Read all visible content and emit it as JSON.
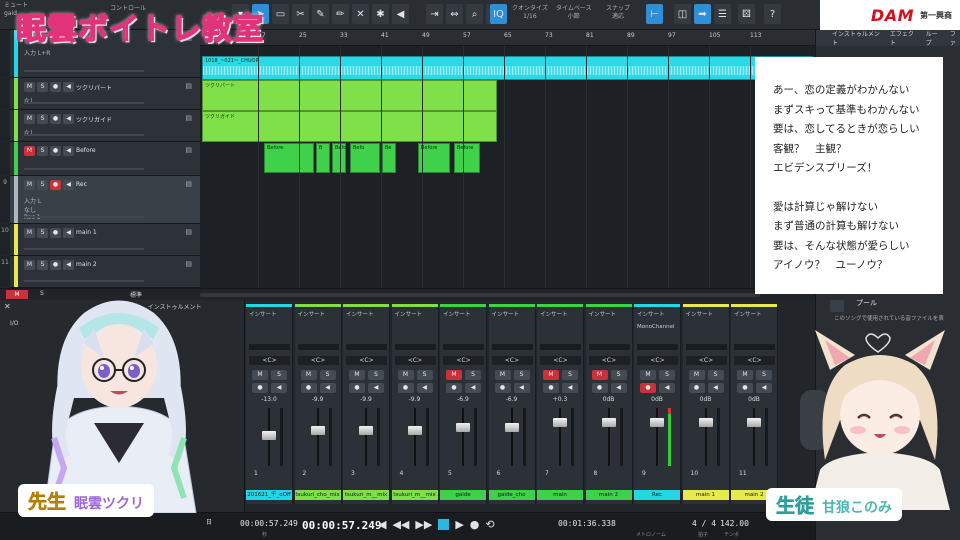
{
  "overlay": {
    "title": "眠雲ボイトレ教室",
    "teacher_role": "先生",
    "teacher_name": "眠雲ツクリ",
    "student_role": "生徒",
    "student_name": "甘狼このみ"
  },
  "brand": {
    "logo": "DAM",
    "sub": "第一興商"
  },
  "toolbar": {
    "left_label_1": "ミュート",
    "left_label_2": "gaid",
    "control_label": "コントロール",
    "quantize_label": "クオンタイズ",
    "quantize_value": "1/16",
    "timebase_label": "タイムベース",
    "timebase_value": "小節",
    "snap_label": "スナップ",
    "snap_value": "適応"
  },
  "ruler": {
    "ticks": [
      "17",
      "25",
      "33",
      "41",
      "49",
      "57",
      "65",
      "73",
      "81",
      "89",
      "97",
      "105",
      "113"
    ]
  },
  "tracks": [
    {
      "num": "",
      "name": "",
      "input": "入力 L+R",
      "color": "#22d7e6",
      "buttons": [
        "M",
        "S"
      ],
      "m_on": false,
      "rec_on": false
    },
    {
      "num": "",
      "name": "ツクリパート",
      "input": "なし",
      "color": "#7fe04a",
      "buttons": [
        "M",
        "S"
      ],
      "m_on": false,
      "rec_on": false
    },
    {
      "num": "",
      "name": "ツクリガイド",
      "input": "なし",
      "color": "#7fe04a",
      "buttons": [
        "M",
        "S"
      ],
      "m_on": false,
      "rec_on": false
    },
    {
      "num": "",
      "name": "Before",
      "input": "",
      "color": "#3fd14a",
      "buttons": [
        "M",
        "S"
      ],
      "m_on": true,
      "rec_on": false
    },
    {
      "num": "9",
      "name": "Rec",
      "input": "入力 L",
      "input2": "なし",
      "input3": "Rec 1",
      "color": "#b0b6bc",
      "buttons": [
        "M",
        "S"
      ],
      "m_on": false,
      "rec_on": true
    },
    {
      "num": "10",
      "name": "main 1",
      "input": "",
      "color": "#e8e94a",
      "buttons": [
        "M",
        "S"
      ],
      "m_on": false,
      "rec_on": false
    },
    {
      "num": "11",
      "name": "main 2",
      "input": "",
      "color": "#e8e94a",
      "buttons": [
        "M",
        "S"
      ],
      "m_on": false,
      "rec_on": false
    }
  ],
  "clips": {
    "top_label": "1018_~021~_CHUOP",
    "tsukuri_part": "ツクリパート",
    "tsukuri_guide": "ツクリガイド",
    "before": [
      "Before",
      "B",
      "Before",
      "Befo",
      "Be",
      "Before",
      "Before"
    ]
  },
  "lyrics": [
    "あー、恋の定義がわかんない",
    "まずスキって基準もわかんない",
    "要は、恋してるときが恋らしい",
    "客観？　主観？",
    "エビデンスプリーズ！",
    "",
    "愛は計算じゃ解けない",
    "まず普通の計算も解けない",
    "要は、そんな状態が愛らしい",
    "アイノウ？　ユーノウ？"
  ],
  "browser": {
    "tabs": [
      "インストゥルメント",
      "エフェクト",
      "ループ",
      "ファ"
    ],
    "pool_title": "プール",
    "pool_desc": "このソングで使用されている音ファイルを表"
  },
  "strip": {
    "m": "M",
    "s": "S",
    "label": "標準"
  },
  "mixer": {
    "left_tabs": [
      "ループ",
      "インストゥルメント"
    ],
    "insert_label": "インサート",
    "pan_label": "<C>",
    "mono_label": "MonoChannel",
    "channels": [
      {
        "num": "1",
        "db": "-13.0",
        "name": "201621_千_oOff",
        "color": "#22d7e6",
        "m_on": false,
        "rec_on": false,
        "level": 0.55
      },
      {
        "num": "2",
        "db": "-9.9",
        "name": "tsukuri_cho_mix",
        "color": "#7fe04a",
        "m_on": false,
        "rec_on": false,
        "level": 0.65
      },
      {
        "num": "3",
        "db": "-9.9",
        "name": "tsukuri_m__mix",
        "color": "#7fe04a",
        "m_on": false,
        "rec_on": false,
        "level": 0.65
      },
      {
        "num": "4",
        "db": "-9.9",
        "name": "tsukuri_m__mix",
        "color": "#7fe04a",
        "m_on": false,
        "rec_on": false,
        "level": 0.65
      },
      {
        "num": "5",
        "db": "-6.9",
        "name": "gaide",
        "color": "#3fd14a",
        "m_on": true,
        "rec_on": false,
        "level": 0.72
      },
      {
        "num": "6",
        "db": "-6.9",
        "name": "gaide_cho",
        "color": "#3fd14a",
        "m_on": false,
        "rec_on": false,
        "level": 0.72
      },
      {
        "num": "7",
        "db": "+0.3",
        "name": "main",
        "color": "#3fd14a",
        "m_on": true,
        "rec_on": false,
        "level": 0.8
      },
      {
        "num": "8",
        "db": "0dB",
        "name": "main 2",
        "color": "#3fd14a",
        "m_on": true,
        "rec_on": false,
        "level": 0.8
      },
      {
        "num": "9",
        "db": "0dB",
        "name": "Rec",
        "color": "#22d7e6",
        "m_on": false,
        "rec_on": true,
        "level": 0.8
      },
      {
        "num": "10",
        "db": "0dB",
        "name": "main 1",
        "color": "#e8e94a",
        "m_on": false,
        "rec_on": false,
        "level": 0.8
      },
      {
        "num": "11",
        "db": "0dB",
        "name": "main 2",
        "color": "#e8e94a",
        "m_on": false,
        "rec_on": false,
        "level": 0.8
      }
    ]
  },
  "transport": {
    "time_small": "00:00:57.249",
    "time_big": "00:00:57.249",
    "sub_sec": "秒",
    "loop_time": "00:01:36.338",
    "meter_label": "メトロノーム",
    "signature": "4 / 4",
    "signature_label": "拍子",
    "tempo": "142.00",
    "tempo_label": "テンポ",
    "day_label": "日"
  }
}
